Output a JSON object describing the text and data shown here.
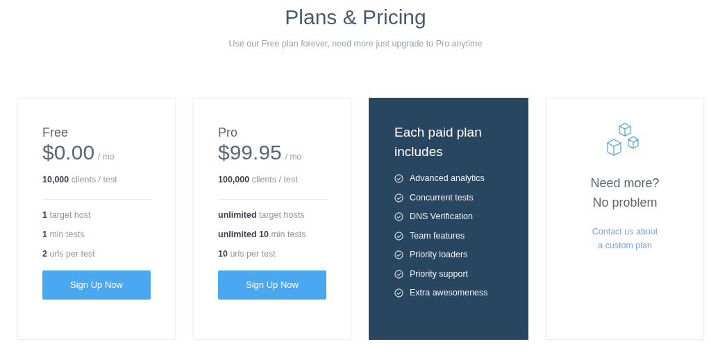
{
  "title": "Plans & Pricing",
  "subtitle": "Use our Free plan forever, need more just upgrade to Pro anytime",
  "plans": [
    {
      "name": "Free",
      "price": "$0.00",
      "period": "/ mo",
      "clients": "**10,000** clients / test",
      "features": [
        "**1** target host",
        "**1** min tests",
        "**2** urls per test"
      ],
      "button": "Sign Up Now"
    },
    {
      "name": "Pro",
      "price": "$99.95",
      "period": "/ mo",
      "clients": "**100,000** clients / test",
      "features": [
        "**unlimited** target hosts",
        "**unlimited 10** min tests",
        "**10** urls per test"
      ],
      "button": "Sign Up Now"
    }
  ],
  "includes": {
    "title": "Each paid plan includes",
    "items": [
      "Advanced analytics",
      "Concurrent tests",
      "DNS Verification",
      "Team features",
      "Priority loaders",
      "Priority support",
      "Extra awesomeness"
    ]
  },
  "custom": {
    "heading_lines": [
      "Need more?",
      "No problem"
    ],
    "link_lines": [
      "Contact us about",
      "a custom plan"
    ]
  }
}
